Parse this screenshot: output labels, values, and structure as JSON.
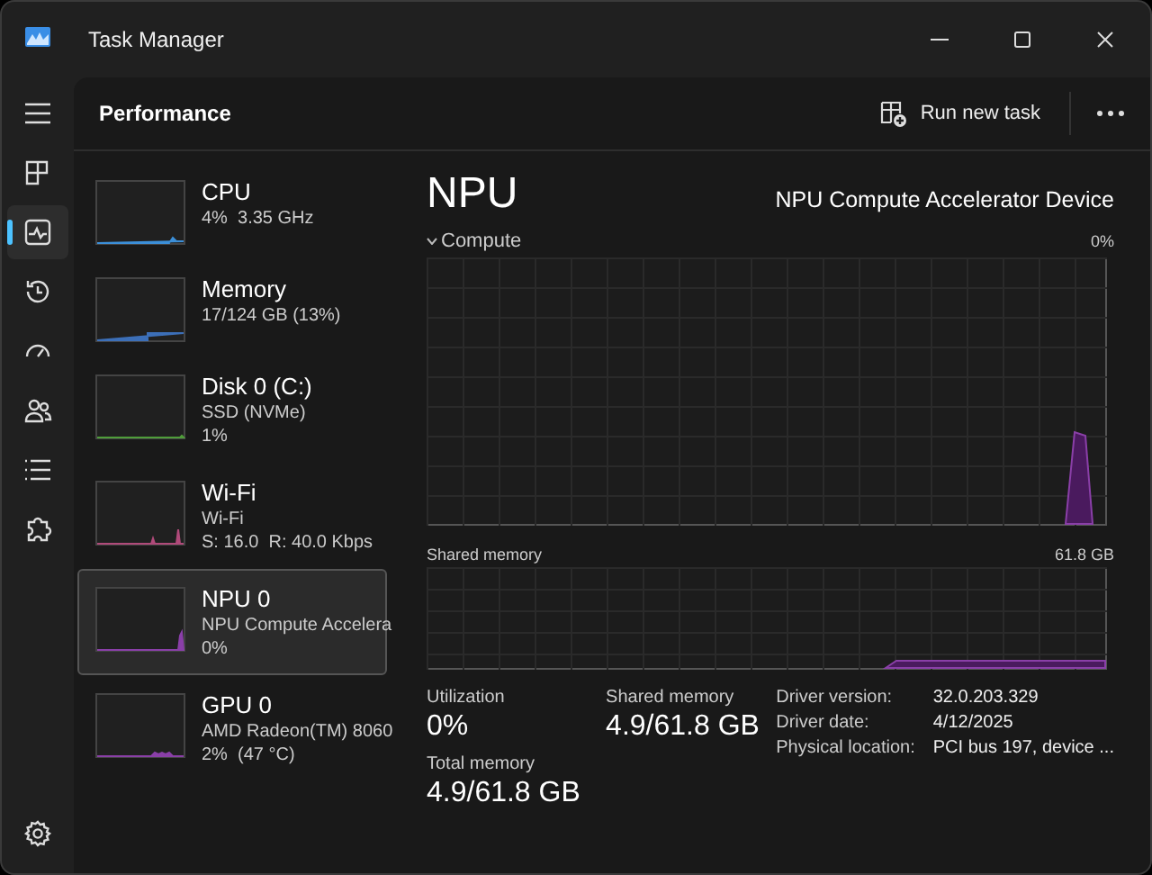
{
  "window": {
    "title": "Task Manager"
  },
  "nav": {
    "items": [
      {
        "kind": "processes",
        "selected": false
      },
      {
        "kind": "performance",
        "selected": true
      },
      {
        "kind": "history",
        "selected": false
      },
      {
        "kind": "startup",
        "selected": false
      },
      {
        "kind": "users",
        "selected": false
      },
      {
        "kind": "details",
        "selected": false
      },
      {
        "kind": "services",
        "selected": false
      }
    ]
  },
  "header": {
    "title": "Performance",
    "action": "Run new task"
  },
  "devices": [
    {
      "name": "CPU",
      "lines": [
        "4%  3.35 GHz"
      ],
      "color": "#3c8fd8",
      "selected": false
    },
    {
      "name": "Memory",
      "lines": [
        "17/124 GB (13%)"
      ],
      "color": "#3c6fb8",
      "selected": false
    },
    {
      "name": "Disk 0 (C:)",
      "lines": [
        "SSD (NVMe)",
        "1%"
      ],
      "color": "#4f9d3a",
      "selected": false
    },
    {
      "name": "Wi-Fi",
      "lines": [
        "Wi-Fi",
        "S: 16.0  R: 40.0 Kbps"
      ],
      "color": "#b04a7a",
      "selected": false
    },
    {
      "name": "NPU 0",
      "lines": [
        "NPU Compute Accelera",
        "0%"
      ],
      "color": "#8a3fa8",
      "selected": true
    },
    {
      "name": "GPU 0",
      "lines": [
        "AMD Radeon(TM) 8060",
        "2%  (47 °C)"
      ],
      "color": "#8a3fa8",
      "selected": false
    }
  ],
  "detail": {
    "title": "NPU",
    "device": "NPU Compute Accelerator Device",
    "compute_label": "Compute",
    "compute_max": "0%",
    "shared_label": "Shared memory",
    "shared_max": "61.8 GB",
    "stats": [
      {
        "label": "Utilization",
        "value": "0%"
      },
      {
        "label": "Shared memory",
        "value": "4.9/61.8 GB"
      },
      {
        "label": "Total memory",
        "value": "4.9/61.8 GB"
      }
    ],
    "info": [
      {
        "label": "Driver version:",
        "value": "32.0.203.329"
      },
      {
        "label": "Driver date:",
        "value": "4/12/2025"
      },
      {
        "label": "Physical location:",
        "value": "PCI bus 197, device ..."
      }
    ]
  }
}
